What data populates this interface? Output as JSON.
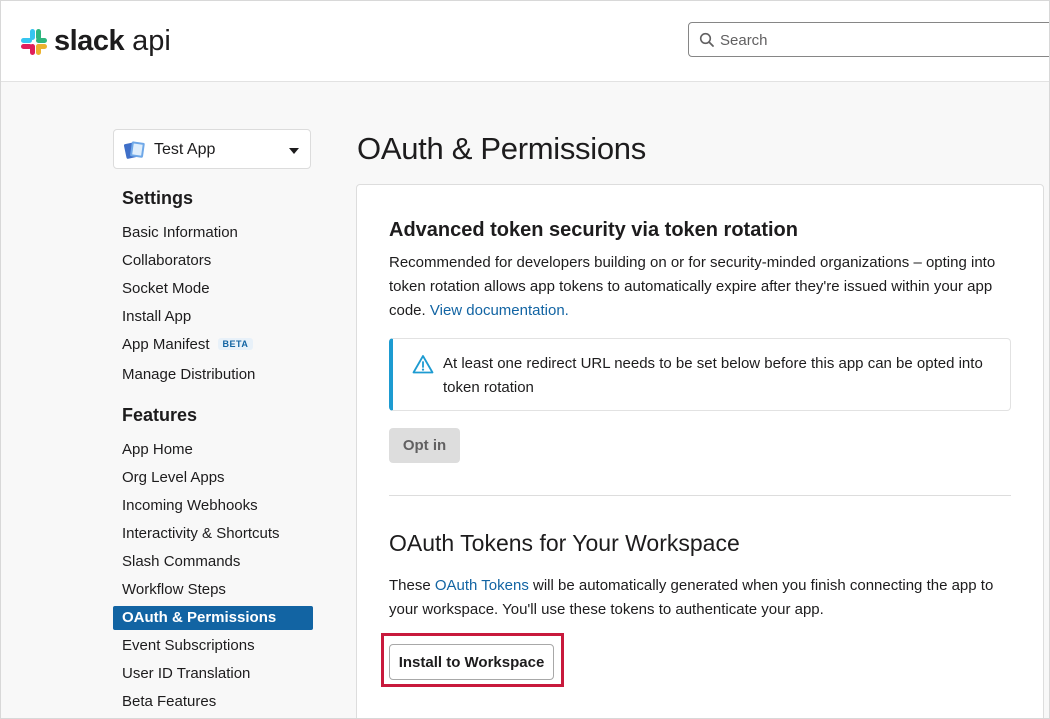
{
  "header": {
    "logo_bold": "slack",
    "logo_light": "api",
    "search_placeholder": "Search"
  },
  "sidebar": {
    "app_name": "Test App",
    "settings_heading": "Settings",
    "settings_items": [
      "Basic Information",
      "Collaborators",
      "Socket Mode",
      "Install App",
      "App Manifest",
      "Manage Distribution"
    ],
    "beta_badge": "BETA",
    "features_heading": "Features",
    "features_items": [
      "App Home",
      "Org Level Apps",
      "Incoming Webhooks",
      "Interactivity & Shortcuts",
      "Slash Commands",
      "Workflow Steps",
      "OAuth & Permissions",
      "Event Subscriptions",
      "User ID Translation",
      "Beta Features"
    ],
    "active_item": "OAuth & Permissions"
  },
  "main": {
    "page_title": "OAuth & Permissions",
    "token_rotation": {
      "title": "Advanced token security via token rotation",
      "description": "Recommended for developers building on or for security-minded organizations – opting into token rotation allows app tokens to automatically expire after they're issued within your app code.",
      "doc_link": "View documentation.",
      "alert_text": "At least one redirect URL needs to be set below before this app can be opted into token rotation",
      "opt_in_label": "Opt in"
    },
    "oauth_tokens": {
      "title": "OAuth Tokens for Your Workspace",
      "desc_before": "These",
      "desc_link": "OAuth Tokens",
      "desc_after": "will be automatically generated when you finish connecting the app to your workspace. You'll use these tokens to authenticate your app.",
      "install_label": "Install to Workspace"
    }
  },
  "colors": {
    "accent_blue": "#1264a3",
    "highlight_red": "#c8193c",
    "alert_border": "#1d9bd1"
  }
}
